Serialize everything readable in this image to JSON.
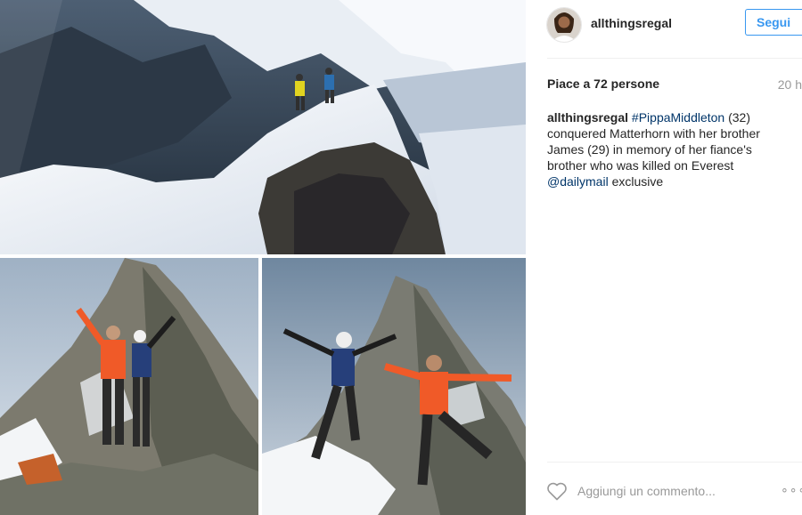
{
  "post": {
    "images": [
      {
        "alt": "",
        "icon": "photo-matterhorn-ridge"
      },
      {
        "alt": "",
        "icon": "photo-summit-pose"
      },
      {
        "alt": "",
        "icon": "photo-summit-jump"
      }
    ]
  },
  "header": {
    "username": "allthingsregal",
    "follow_label": "Segui",
    "avatar_icon": "user-avatar"
  },
  "likes": {
    "text": "Piace a 72 persone"
  },
  "timestamp": "20 h",
  "caption": {
    "username": "allthingsregal",
    "hashtag": "#PippaMiddleton",
    "text_1": " (32) conquered Matterhorn with her brother James (29) in memory of her fiance's brother who was killed on Everest ",
    "mention": "@dailymail",
    "text_2": " exclusive"
  },
  "comment": {
    "placeholder": "Aggiungi un commento...",
    "more_label": "∘∘∘",
    "heart_icon": "heart-outline-icon"
  },
  "colors": {
    "follow_blue": "#3897f0",
    "link": "#003569",
    "muted": "#999999",
    "jacket_orange": "#f05a28"
  }
}
